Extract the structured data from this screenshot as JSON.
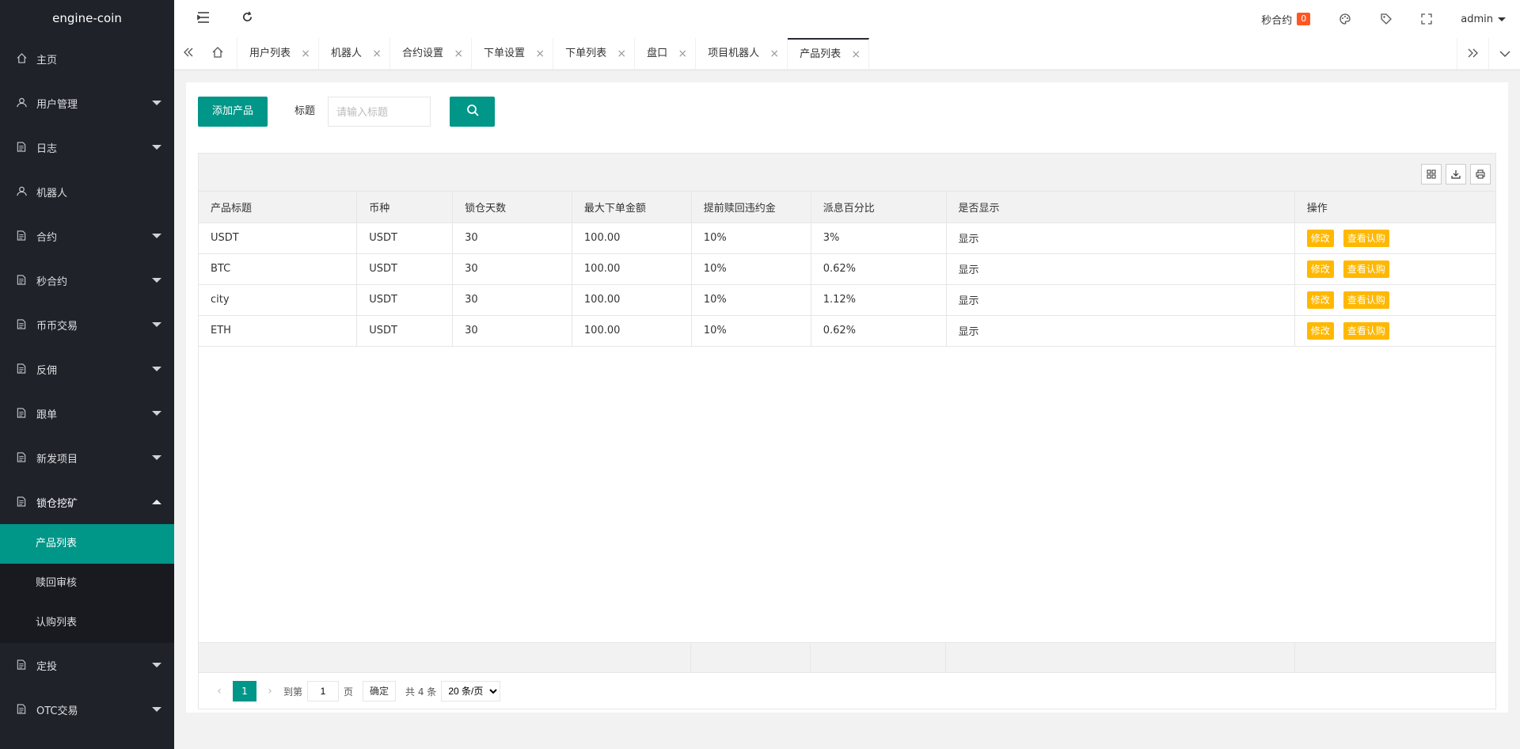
{
  "app": {
    "title": "engine-coin"
  },
  "sidebar": {
    "items": [
      {
        "label": "主页",
        "icon": "home-icon",
        "has_caret": false
      },
      {
        "label": "用户管理",
        "icon": "user-icon",
        "has_caret": true
      },
      {
        "label": "日志",
        "icon": "doc-icon",
        "has_caret": true
      },
      {
        "label": "机器人",
        "icon": "user-icon",
        "has_caret": false
      },
      {
        "label": "合约",
        "icon": "doc-icon",
        "has_caret": true
      },
      {
        "label": "秒合约",
        "icon": "doc-icon",
        "has_caret": true
      },
      {
        "label": "币币交易",
        "icon": "doc-icon",
        "has_caret": true
      },
      {
        "label": "反佣",
        "icon": "doc-icon",
        "has_caret": true
      },
      {
        "label": "跟单",
        "icon": "doc-icon",
        "has_caret": true
      },
      {
        "label": "新发项目",
        "icon": "doc-icon",
        "has_caret": true
      },
      {
        "label": "锁仓挖矿",
        "icon": "doc-icon",
        "has_caret": true
      }
    ],
    "submenu": [
      {
        "label": "产品列表",
        "active": true
      },
      {
        "label": "赎回审核",
        "active": false
      },
      {
        "label": "认购列表",
        "active": false
      }
    ],
    "items_after": [
      {
        "label": "定投",
        "icon": "doc-icon",
        "has_caret": true
      },
      {
        "label": "OTC交易",
        "icon": "doc-icon",
        "has_caret": true
      }
    ]
  },
  "header": {
    "notify_label": "秒合约",
    "notify_count": "0",
    "user": "admin"
  },
  "tabs": [
    {
      "label": "用户列表",
      "active": false
    },
    {
      "label": "机器人",
      "active": false
    },
    {
      "label": "合约设置",
      "active": false
    },
    {
      "label": "下单设置",
      "active": false
    },
    {
      "label": "下单列表",
      "active": false
    },
    {
      "label": "盘口",
      "active": false
    },
    {
      "label": "项目机器人",
      "active": false
    },
    {
      "label": "产品列表",
      "active": true
    }
  ],
  "search": {
    "add_label": "添加产品",
    "title_label": "标题",
    "title_placeholder": "请输入标题"
  },
  "table": {
    "columns": [
      "产品标题",
      "币种",
      "锁仓天数",
      "最大下单金额",
      "提前赎回违约金",
      "派息百分比",
      "是否显示",
      "操作"
    ],
    "rows": [
      [
        "USDT",
        "USDT",
        "30",
        "100.00",
        "10%",
        "3%",
        "显示"
      ],
      [
        "BTC",
        "USDT",
        "30",
        "100.00",
        "10%",
        "0.62%",
        "显示"
      ],
      [
        "city",
        "USDT",
        "30",
        "100.00",
        "10%",
        "1.12%",
        "显示"
      ],
      [
        "ETH",
        "USDT",
        "30",
        "100.00",
        "10%",
        "0.62%",
        "显示"
      ]
    ],
    "edit_label": "修改",
    "view_label": "查看认购"
  },
  "pager": {
    "current": "1",
    "goto_label": "到第",
    "goto_value": "1",
    "page_label": "页",
    "confirm_label": "确定",
    "total_label": "共 4 条",
    "page_size_label": "20 条/页"
  }
}
